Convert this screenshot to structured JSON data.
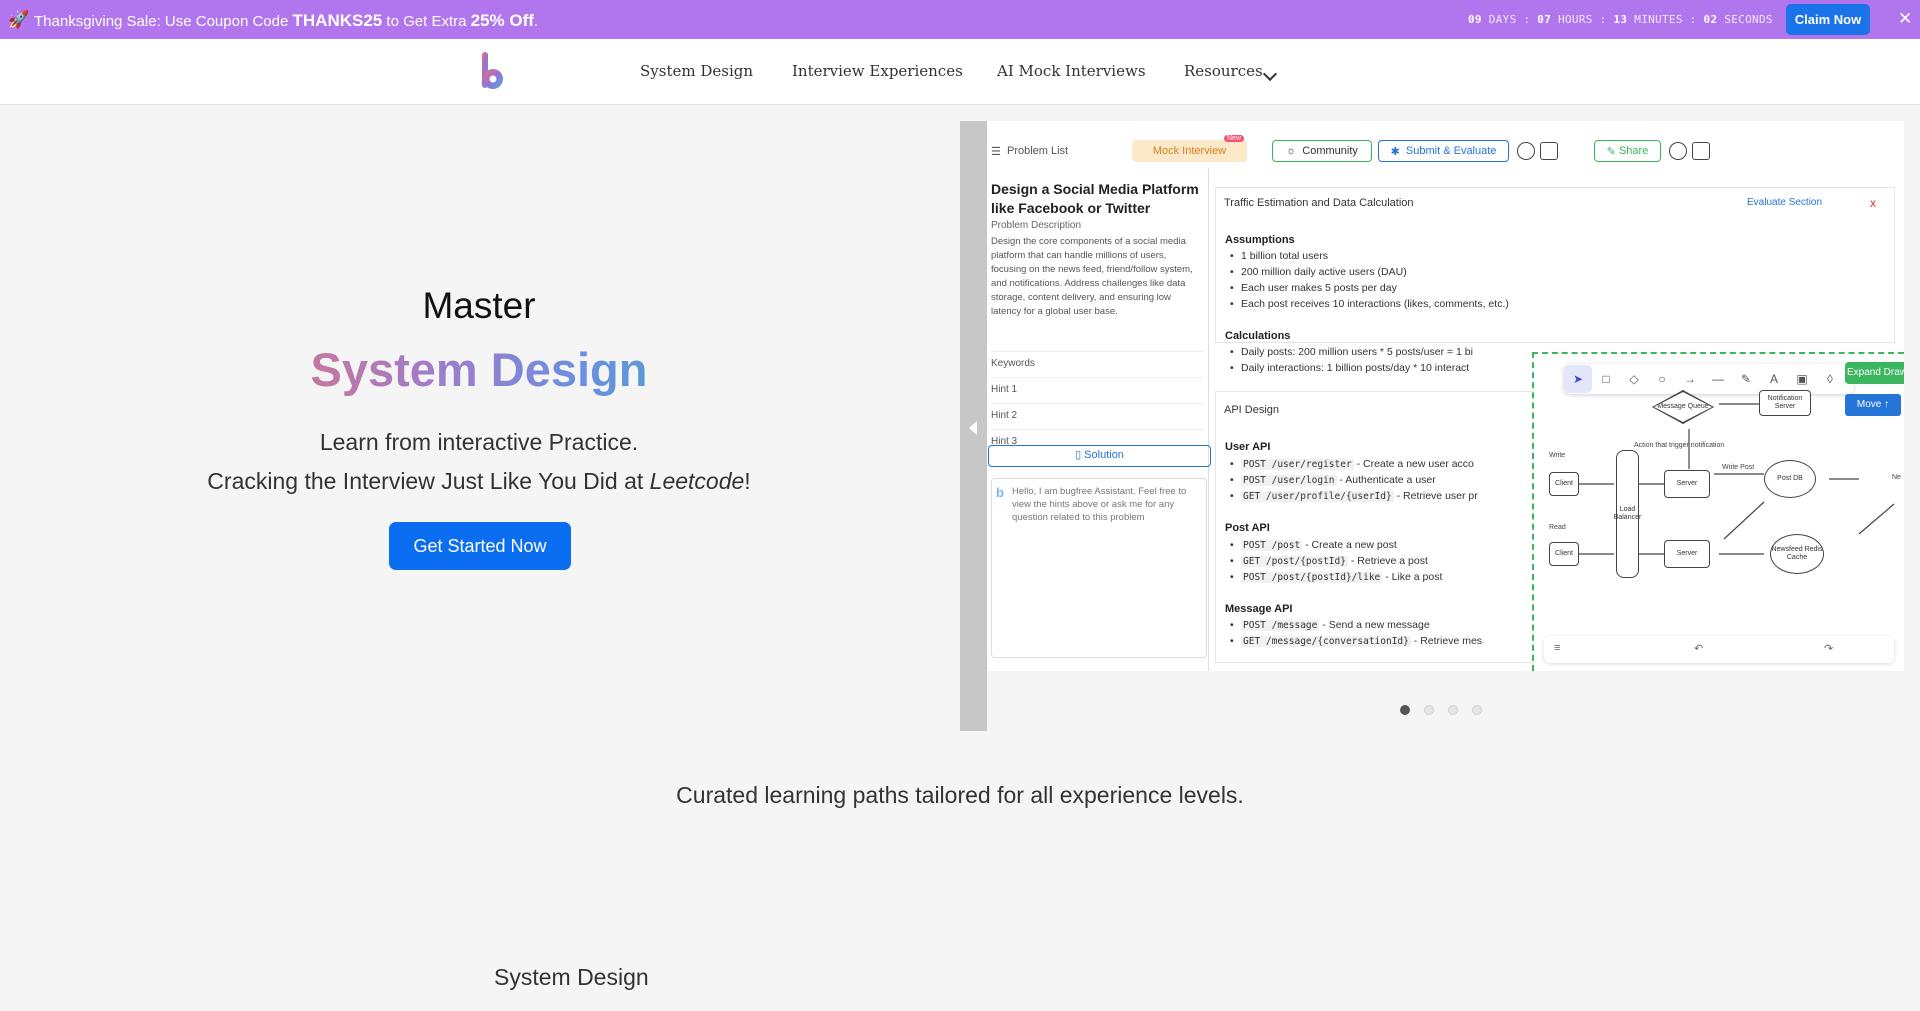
{
  "promo": {
    "icon": "rocket-icon",
    "prefix": "Thanksgiving Sale: Use Coupon Code ",
    "code": "THANKS25",
    "middle": " to Get Extra ",
    "discount": "25% Off",
    "suffix": ".",
    "countdown": {
      "days": "09",
      "days_label": "DAYS",
      "hours": "07",
      "hours_label": "HOURS",
      "minutes": "13",
      "minutes_label": "MINUTES",
      "seconds": "02",
      "seconds_label": "SECONDS"
    },
    "claim_label": "Claim Now",
    "close": "✕"
  },
  "nav": {
    "items": [
      "System Design",
      "Interview Experiences",
      "AI Mock Interviews",
      "Resources"
    ]
  },
  "hero": {
    "master": "Master",
    "gradient": "System Design",
    "line1": "Learn from interactive Practice.",
    "line2_prefix": "Cracking the Interview Just Like You Did at ",
    "line2_em": "Leetcode",
    "line2_suffix": "!",
    "cta": "Get Started Now"
  },
  "preview": {
    "toolbar": {
      "problem_list": "Problem List",
      "mock_interview": "Mock Interview",
      "new_badge": "New",
      "community": "Community",
      "submit": "Submit & Evaluate",
      "share": "Share"
    },
    "problem": {
      "title": "Design a Social Media Platform like Facebook or Twitter",
      "desc_label": "Problem Description",
      "desc": "Design the core components of a social media platform that can handle millions of users, focusing on the news feed, friend/follow system, and notifications. Address challenges like data storage, content delivery, and ensuring low latency for a global user base.",
      "rows": [
        "Keywords",
        "Hint 1",
        "Hint 2",
        "Hint 3"
      ],
      "solution": "Solution",
      "assistant": "Hello, I am bugfree Assistant. Feel free to view the hints above or ask me for any question related to this problem"
    },
    "traffic": {
      "title": "Traffic Estimation and Data Calculation",
      "evaluate": "Evaluate Section",
      "close": "x",
      "assumptions_label": "Assumptions",
      "assumptions": [
        "1 billion total users",
        "200 million daily active users (DAU)",
        "Each user makes 5 posts per day",
        "Each post receives 10 interactions (likes, comments, etc.)"
      ],
      "calculations_label": "Calculations",
      "calculations": [
        "Daily posts: 200 million users * 5 posts/user = 1 bi",
        "Daily interactions: 1 billion posts/day * 10 interact"
      ]
    },
    "api": {
      "title": "API Design",
      "user_label": "User API",
      "user": [
        {
          "code": "POST /user/register",
          "text": " - Create a new user acco"
        },
        {
          "code": "POST /user/login",
          "text": " - Authenticate a user"
        },
        {
          "code": "GET /user/profile/{userId}",
          "text": " - Retrieve user pr"
        }
      ],
      "post_label": "Post API",
      "post": [
        {
          "code": "POST /post",
          "text": " - Create a new post"
        },
        {
          "code": "GET /post/{postId}",
          "text": " - Retrieve a post"
        },
        {
          "code": "POST /post/{postId}/like",
          "text": " - Like a post"
        }
      ],
      "message_label": "Message API",
      "message": [
        {
          "code": "POST /message",
          "text": " - Send a new message"
        },
        {
          "code": "GET /message/{conversationId}",
          "text": " - Retrieve mes"
        }
      ]
    },
    "draw": {
      "expand": "Expand Draw",
      "move": "Move",
      "nodes": {
        "queue": "Message Queue",
        "notif": "Notification Server",
        "client1": "Client",
        "lb": "Load Balancer",
        "server1": "Server",
        "postdb": "Post DB",
        "client2": "Client",
        "server2": "Server",
        "cache": "Newsfeed Redis Cache",
        "write": "Write",
        "read": "Read",
        "action": "Action that trigger notification",
        "writepost": "Write Post",
        "ne": "Ne"
      }
    },
    "slides": 4,
    "active_slide": 0
  },
  "curated": "Curated learning paths tailored for all experience levels.",
  "section_title": "System Design"
}
